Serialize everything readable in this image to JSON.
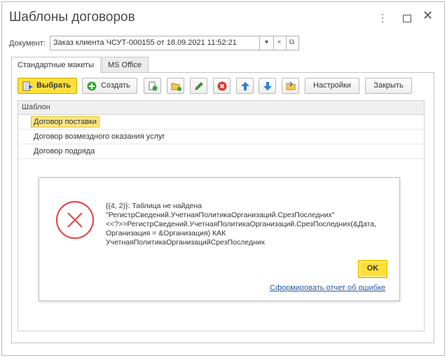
{
  "window": {
    "title": "Шаблоны договоров",
    "more_icon": "more-vertical-icon",
    "maximize_icon": "maximize-icon",
    "close_icon": "close-icon"
  },
  "document": {
    "label": "Документ:",
    "value": "Заказ клиента ЧСУТ-000155 от 18.09.2021 11:52:21",
    "dropdown_symbol": "▾",
    "clear_symbol": "×",
    "open_symbol": "⧉"
  },
  "tabs": [
    {
      "label": "Стандартные макеты",
      "active": true
    },
    {
      "label": "MS Office",
      "active": false
    }
  ],
  "toolbar": {
    "select_label": "Выбрать",
    "create_label": "Создать",
    "settings_label": "Настройки",
    "close_label": "Закрыть"
  },
  "table": {
    "header": "Шаблон",
    "rows": [
      "Договор поставки",
      "Договор возмездного оказания услуг",
      "Договор подряда"
    ]
  },
  "error_dialog": {
    "message_lines": [
      "{(4, 2)}: Таблица не найдена",
      "\"РегистрСведений.УчетнаяПолитикаОрганизаций.СрезПоследних\"",
      "<<?>>РегистрСведений.УчетнаяПолитикаОрганизаций.СрезПоследних(&Дата,",
      "Организация = &Организация) КАК",
      "УчетнаяПолитикаОрганизацийСрезПоследних"
    ],
    "ok_label": "OK",
    "report_link": "Сформировать отчет об ошибке",
    "icon": "error-circle-x-icon"
  },
  "colors": {
    "accent_yellow": "#ffdf3a",
    "error_red": "#e84a4a",
    "link_blue": "#2a5a9a"
  }
}
